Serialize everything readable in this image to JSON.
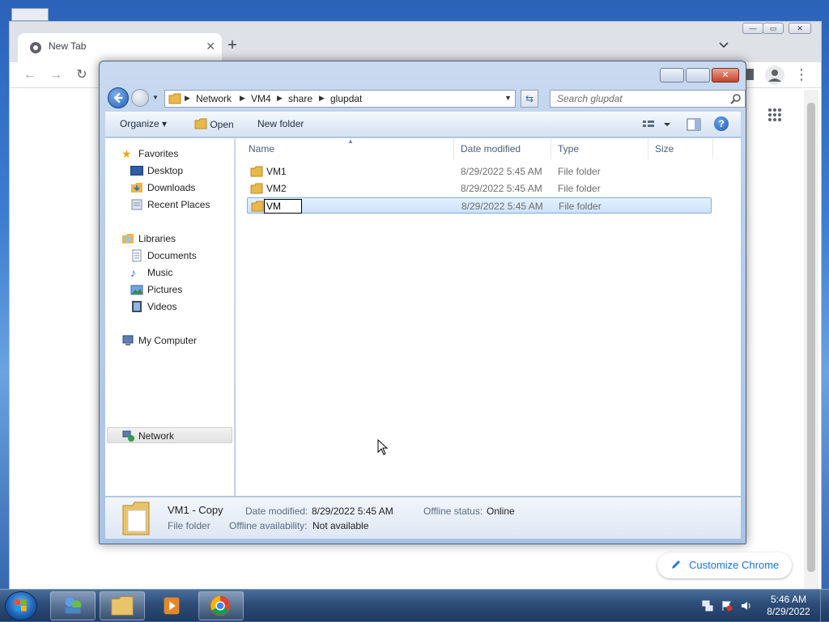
{
  "chrome": {
    "tab_title": "New Tab",
    "customize_label": "Customize Chrome"
  },
  "dialog": {
    "address": {
      "crumbs": [
        "Network",
        "VM4",
        "share",
        "glupdat"
      ]
    },
    "search_placeholder": "Search glupdat",
    "commands": {
      "organize": "Organize",
      "open": "Open",
      "new_folder": "New folder"
    },
    "nav": {
      "favorites": "Favorites",
      "desktop": "Desktop",
      "downloads": "Downloads",
      "recent_places": "Recent Places",
      "libraries": "Libraries",
      "documents": "Documents",
      "music": "Music",
      "pictures": "Pictures",
      "videos": "Videos",
      "my_computer": "My Computer",
      "network": "Network"
    },
    "columns": {
      "name": "Name",
      "date_modified": "Date modified",
      "type": "Type",
      "size": "Size"
    },
    "files": [
      {
        "name": "VM1",
        "date": "8/29/2022 5:45 AM",
        "type": "File folder"
      },
      {
        "name": "VM2",
        "date": "8/29/2022 5:45 AM",
        "type": "File folder"
      },
      {
        "name": "VM",
        "date": "8/29/2022 5:45 AM",
        "type": "File folder"
      }
    ],
    "details": {
      "name": "VM1 - Copy",
      "kind": "File folder",
      "date_modified_label": "Date modified:",
      "date_modified_value": "8/29/2022 5:45 AM",
      "offline_availability_label": "Offline availability:",
      "offline_availability_value": "Not available",
      "offline_status_label": "Offline status:",
      "offline_status_value": "Online"
    }
  },
  "taskbar": {
    "time": "5:46 AM",
    "date": "8/29/2022"
  },
  "colors": {
    "selection_bg": "#cce3fb",
    "selection_border": "#84acdd",
    "chrome_accent": "#1a73e8"
  }
}
